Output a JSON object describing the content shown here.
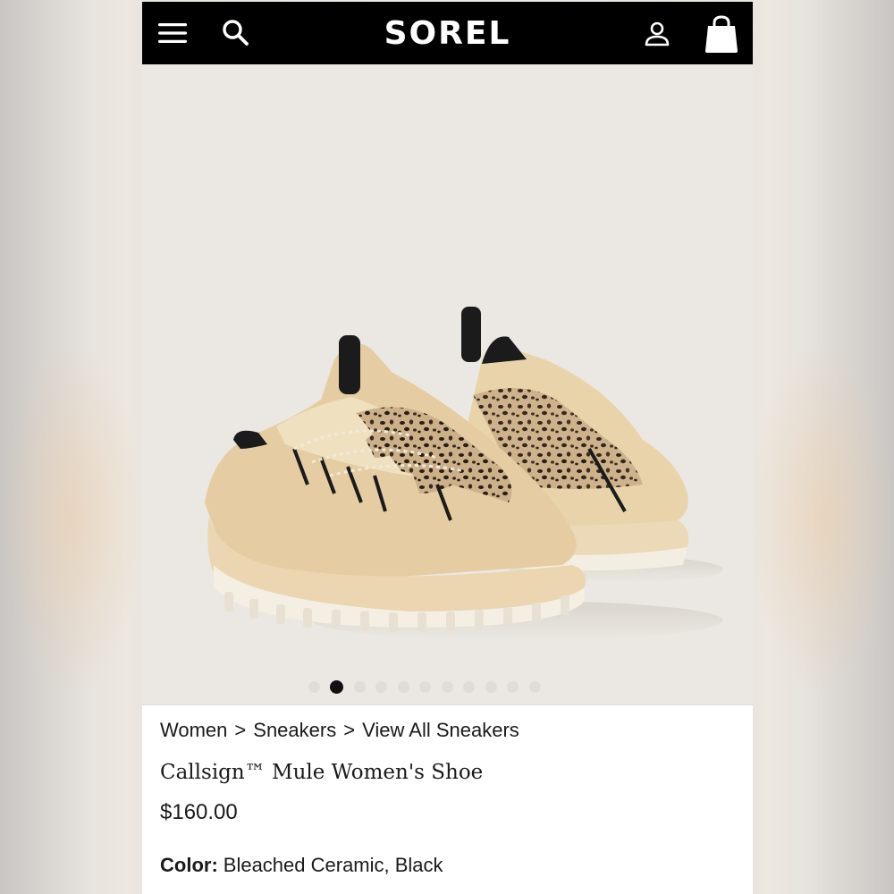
{
  "header": {
    "brand": "SOREL",
    "icons": [
      "menu-icon",
      "search-icon",
      "account-icon",
      "shopping-bag-icon"
    ]
  },
  "gallery": {
    "slide_count": 11,
    "active_slide": 2
  },
  "breadcrumb": {
    "items": [
      "Women",
      "Sneakers",
      "View All Sneakers"
    ],
    "separator": ">"
  },
  "product": {
    "title": "Callsign™ Mule Women's Shoe",
    "price": "$160.00",
    "color_label": "Color:",
    "color_value": "Bleached Ceramic, Black"
  },
  "colors": {
    "header_bg": "#000000",
    "image_bg": "#ebe8e3",
    "text": "#1a1a1a"
  }
}
